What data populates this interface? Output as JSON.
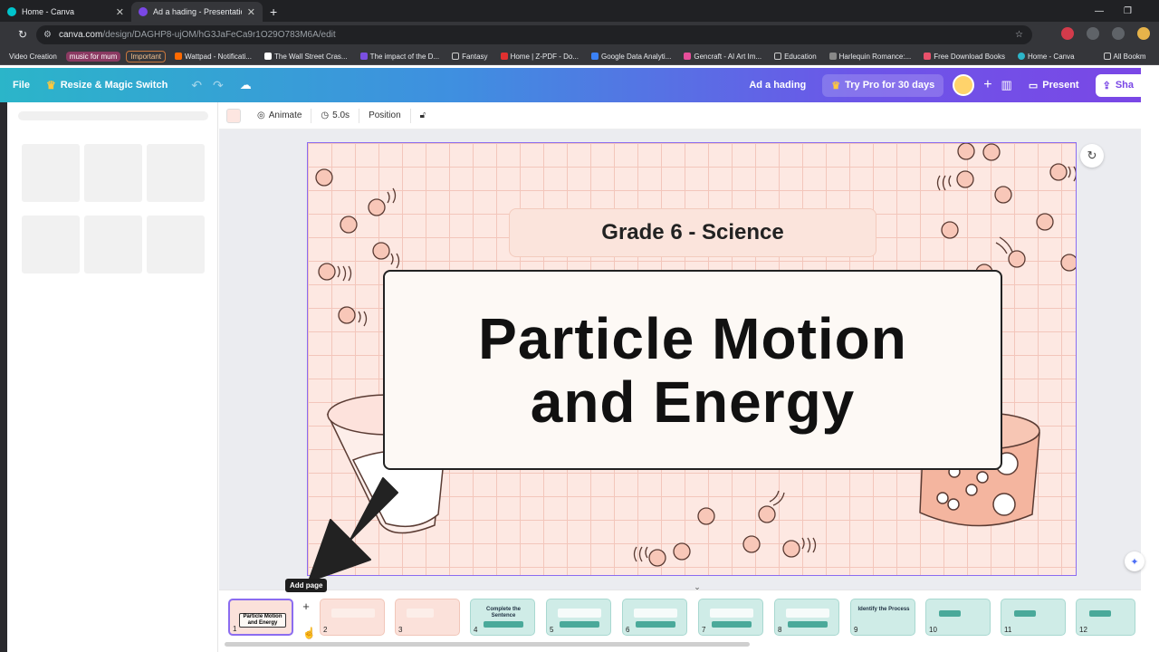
{
  "browser": {
    "tabs": [
      {
        "title": "Home - Canva",
        "active": false
      },
      {
        "title": "Ad a hading - Presentation",
        "active": true
      }
    ],
    "url_main": "canva.com",
    "url_rest": "/design/DAGHP8-ujOM/hG3JaFeCa9r1O29O783M6A/edit",
    "bookmarks": [
      "Video Creation",
      "music for mum",
      "Important",
      "Wattpad - Notificati...",
      "The Wall Street Cras...",
      "The impact of the D...",
      "Fantasy",
      "Home | Z-PDF - Do...",
      "Google Data Analyti...",
      "Gencraft - AI Art Im...",
      "Education",
      "Harlequin Romance:...",
      "Free Download Books",
      "Home - Canva",
      "All Bookm"
    ]
  },
  "canva": {
    "file_label": "File",
    "resize_label": "Resize & Magic Switch",
    "doc_name": "Ad a hading",
    "try_pro": "Try Pro for 30 days",
    "present": "Present",
    "share": "Sha"
  },
  "toolbar": {
    "animate": "Animate",
    "duration": "5.0s",
    "position": "Position"
  },
  "slide": {
    "subtitle": "Grade 6 - Science",
    "title_line1": "Particle Motion",
    "title_line2": "and Energy"
  },
  "filmstrip": {
    "add_page_tooltip": "Add page",
    "pages": [
      {
        "n": "1",
        "label": "Particle Motion and Energy"
      },
      {
        "n": "2",
        "label": ""
      },
      {
        "n": "3",
        "label": ""
      },
      {
        "n": "4",
        "label": "Complete the Sentence"
      },
      {
        "n": "5",
        "label": ""
      },
      {
        "n": "6",
        "label": ""
      },
      {
        "n": "7",
        "label": ""
      },
      {
        "n": "8",
        "label": ""
      },
      {
        "n": "9",
        "label": "Identify the Process"
      },
      {
        "n": "10",
        "label": ""
      },
      {
        "n": "11",
        "label": ""
      },
      {
        "n": "12",
        "label": ""
      }
    ]
  },
  "colors": {
    "slide_bg": "#fde8e2",
    "accent": "#8b6cf0",
    "teal_thumb": "#cfece7"
  }
}
